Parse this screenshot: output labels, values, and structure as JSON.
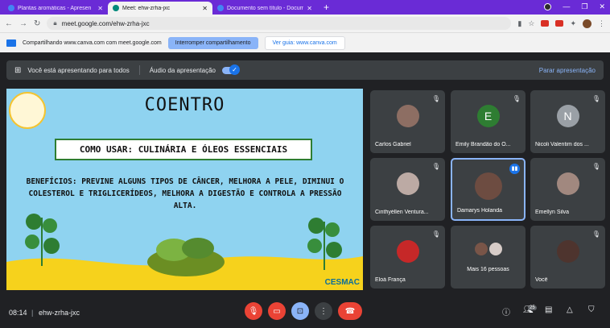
{
  "browser": {
    "tabs": [
      {
        "title": "Plantas aromáticas - Apresen",
        "favicon_color": "#4285f4",
        "active": false
      },
      {
        "title": "Meet: ehw-zrha-jxc",
        "favicon_color": "#00897b",
        "active": true
      },
      {
        "title": "Documento sem título - Docume",
        "favicon_color": "#4285f4",
        "active": false
      }
    ],
    "new_tab": "+",
    "url": "meet.google.com/ehw-zrha-jxc"
  },
  "share_bar": {
    "text": "Compartilhando www.canva.com com meet.google.com",
    "stop_button": "Interromper compartilhamento",
    "view_button": "Ver guia: www.canva.com"
  },
  "presenting": {
    "text": "Você está apresentando para todos",
    "audio_label": "Áudio da apresentação",
    "stop": "Parar apresentação"
  },
  "slide": {
    "title": "COENTRO",
    "subtitle": "COMO USAR: CULINÁRIA E ÓLEOS ESSENCIAIS",
    "body": "BENEFÍCIOS: PREVINE ALGUNS TIPOS DE CÂNCER, MELHORA A PELE, DIMINUI O COLESTEROL E TRIGLICERÍDEOS, MELHORA A DIGESTÃO E CONTROLA A PRESSÃO ALTA.",
    "brand": "CESMAC"
  },
  "participants": [
    {
      "name": "Carlos Gabriel",
      "avatar": "photo",
      "color": "#8d6e63"
    },
    {
      "name": "Emily Brandão do O...",
      "avatar": "E",
      "color": "#2e7d32"
    },
    {
      "name": "Nicoli Valentim dos ...",
      "avatar": "N",
      "color": "#9aa0a6"
    },
    {
      "name": "Cinthyéllen Ventura...",
      "avatar": "photo",
      "color": "#bcaaa4"
    },
    {
      "name": "Damarys Holanda",
      "avatar": "photo",
      "color": "#6d4c41"
    },
    {
      "name": "Emellyn Silva",
      "avatar": "photo",
      "color": "#a1887f"
    },
    {
      "name": "Eloá França",
      "avatar": "photo",
      "color": "#c62828"
    },
    {
      "name": "Mais 16 pessoas",
      "avatar": "pair",
      "color": "#795548"
    },
    {
      "name": "Você",
      "avatar": "photo",
      "color": "#4e342e"
    }
  ],
  "bottom": {
    "time": "08:14",
    "separator": "|",
    "meeting_code": "ehw-zrha-jxc",
    "people_count": "25"
  },
  "icons": {
    "mic_off": "mic-off-icon",
    "cam_off": "camera-off-icon",
    "present": "present-icon",
    "more": "more-icon",
    "end": "end-call-icon"
  }
}
